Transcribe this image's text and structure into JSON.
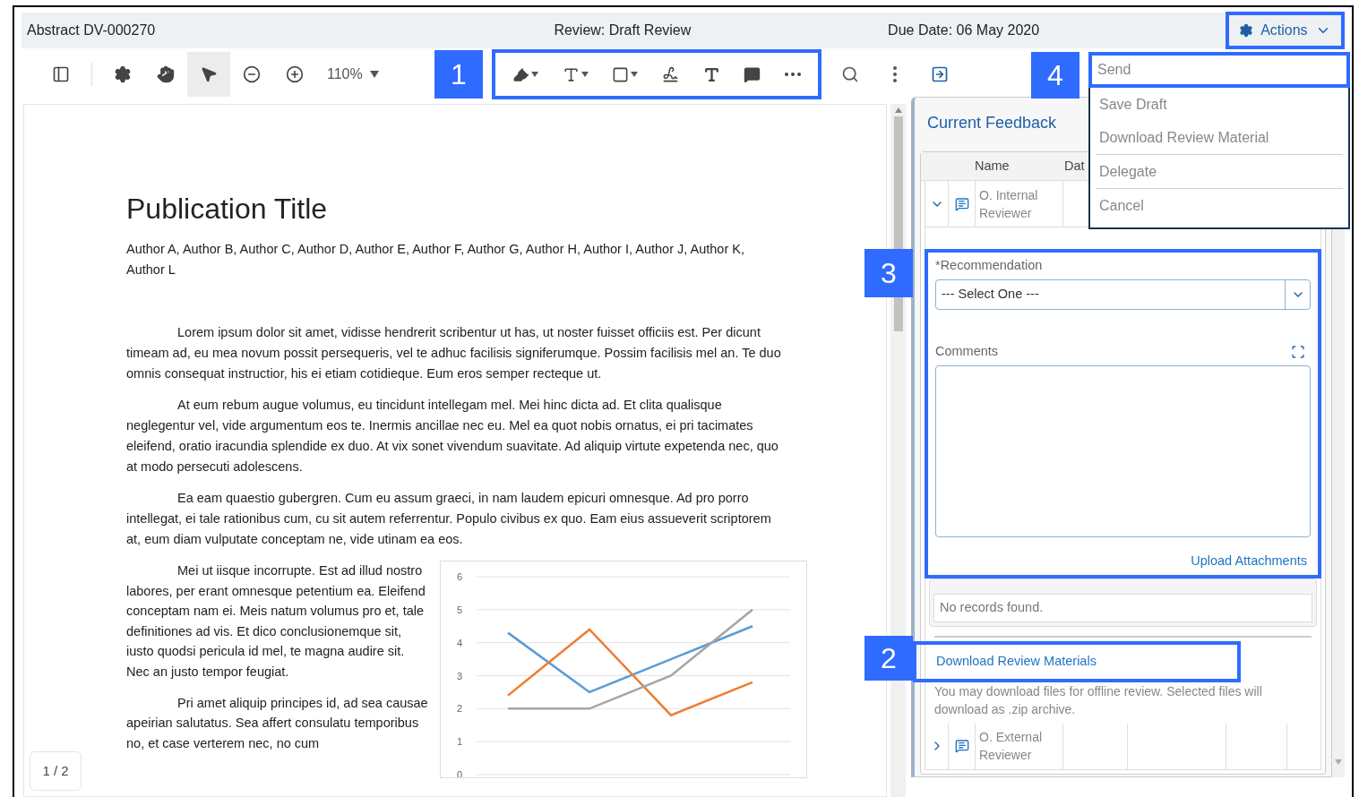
{
  "header": {
    "title": "Abstract DV-000270",
    "review": "Review: Draft Review",
    "due_date": "Due Date: 06 May 2020",
    "actions_button": "Actions"
  },
  "toolbar": {
    "tools": [
      {
        "kind": "sidebar",
        "selected": false
      },
      {
        "kind": "settings",
        "selected": false
      },
      {
        "kind": "hand",
        "selected": false
      },
      {
        "kind": "pointer",
        "selected": true
      },
      {
        "kind": "zoom-out",
        "selected": false
      },
      {
        "kind": "zoom-in",
        "selected": false
      }
    ],
    "zoom": "110%",
    "callout": "1",
    "annotate_tools": [
      {
        "kind": "pen"
      },
      {
        "kind": "text-box"
      },
      {
        "kind": "shape"
      },
      {
        "kind": "signature"
      },
      {
        "kind": "text"
      },
      {
        "kind": "comment"
      },
      {
        "kind": "more"
      }
    ],
    "right_tools": [
      {
        "kind": "search"
      },
      {
        "kind": "menu"
      },
      {
        "kind": "panel"
      }
    ]
  },
  "document": {
    "title": "Publication Title",
    "authors": "Author A, Author B, Author C, Author D, Author E, Author F, Author G, Author H, Author I, Author J, Author K, Author L",
    "paragraphs": [
      "Lorem ipsum dolor sit amet, vidisse hendrerit scribentur ut has, ut noster fuisset officiis est. Per dicunt timeam ad, eu mea novum possit persequeris, vel te adhuc facilisis signiferumque. Possim facilisis mel an. Te duo omnis consequat instructior, his ei etiam cotidieque. Eum eros semper recteque ut.",
      "At eum rebum augue volumus, eu tincidunt intellegam mel. Mei hinc dicta ad. Et clita qualisque neglegentur vel, vide argumentum eos te. Inermis ancillae nec eu. Mel ea quot nobis ornatus, ei pri tacimates eleifend, oratio iracundia splendide ex duo. At vix sonet vivendum suavitate. Ad aliquip virtute expetenda nec, quo at modo persecuti adolescens.",
      "Ea eam quaestio gubergren. Cum eu assum graeci, in nam laudem epicuri omnesque. Ad pro porro intellegat, ei tale rationibus cum, cu sit autem referrentur. Populo civibus ex quo. Eam eius assueverit scriptorem at, eum diam vulputate conceptam ne, vide utinam ea eos."
    ],
    "side_paragraphs": [
      "Mei ut iisque incorrupte. Est ad illud nostro labores, per erant omnesque petentium ea. Eleifend conceptam nam ei. Meis natum volumus pro et, tale definitiones ad vis. Et dico conclusionemque sit, iusto quodsi pericula id mel, te magna audire sit. Nec an justo tempor feugiat.",
      "Pri amet aliquip principes id, ad sea causae apeirian salutatus. Sea affert consulatu temporibus no, et case verterem nec, no cum"
    ],
    "chart_data": {
      "type": "line",
      "ylim": [
        0,
        6
      ],
      "yticks": [
        0,
        1,
        2,
        3,
        4,
        5,
        6
      ],
      "grid": true,
      "series": [
        {
          "color": "#5b9bd5",
          "values": [
            4.3,
            2.5,
            3.5,
            4.5
          ]
        },
        {
          "color": "#ed7d31",
          "values": [
            2.4,
            4.4,
            1.8,
            2.8
          ]
        },
        {
          "color": "#a5a5a5",
          "values": [
            2,
            2,
            3,
            5
          ]
        }
      ]
    },
    "page_indicator": "1 / 2"
  },
  "feedback": {
    "title": "Current Feedback",
    "columns": [
      "Name",
      "Dat"
    ],
    "rows": [
      {
        "name": "O. Internal Reviewer",
        "expanded": true
      },
      {
        "name": "O. External Reviewer",
        "expanded": false
      }
    ],
    "form_callout": "3",
    "recommendation_label": "*Recommendation",
    "recommendation_value": "--- Select One ---",
    "comments_label": "Comments",
    "upload_link": "Upload Attachments",
    "no_records": "No records found.",
    "download_callout": "2",
    "download_link": "Download Review Materials",
    "download_note": "You may download files for offline review. Selected files will download as .zip archive."
  },
  "actions_menu": {
    "callout": "4",
    "groups": [
      [
        {
          "label": "Send",
          "selected": true
        },
        {
          "label": "Save Draft",
          "selected": false
        },
        {
          "label": "Download Review Material",
          "selected": false
        }
      ],
      [
        {
          "label": "Delegate",
          "selected": false
        }
      ],
      [
        {
          "label": "Cancel",
          "selected": false
        }
      ]
    ]
  }
}
